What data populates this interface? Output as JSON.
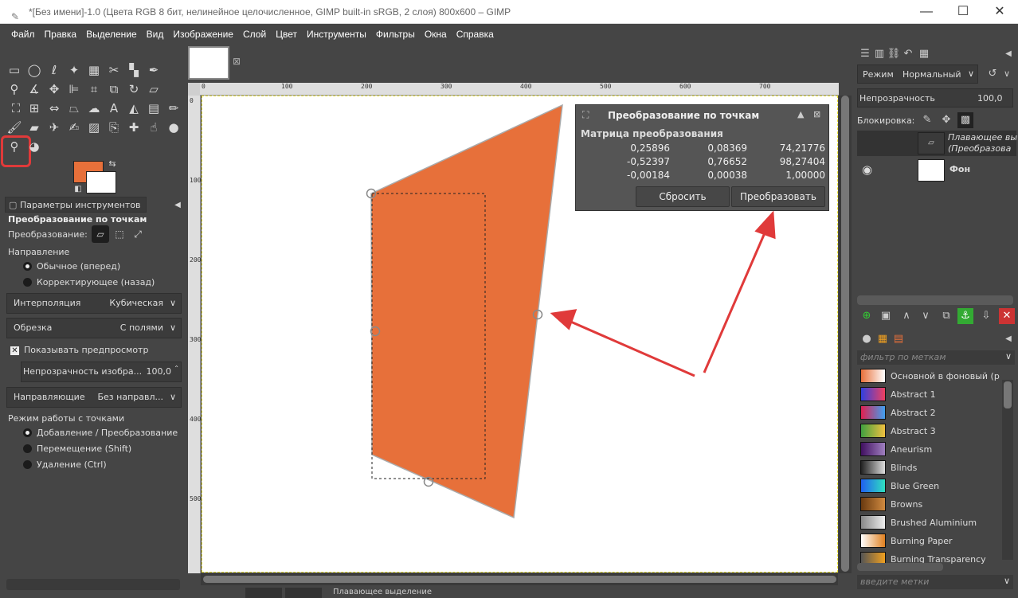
{
  "window": {
    "title": "*[Без имени]-1.0 (Цвета RGB 8 бит, нелинейное целочисленное, GIMP built-in sRGB, 2 слоя) 800x600 – GIMP",
    "minimize": "—",
    "maximize": "☐",
    "close": "✕"
  },
  "menu": [
    "Файл",
    "Правка",
    "Выделение",
    "Вид",
    "Изображение",
    "Слой",
    "Цвет",
    "Инструменты",
    "Фильтры",
    "Окна",
    "Справка"
  ],
  "colors": {
    "foreground": "#e7703a",
    "background": "#ffffff",
    "highlight": "#e03a3a",
    "arrow": "#e03a3a"
  },
  "tool_options": {
    "tab_label": "Параметры инструментов",
    "tool_name": "Преобразование по точкам",
    "transform_label": "Преобразование:",
    "direction_label": "Направление",
    "direction_options": [
      "Обычное (вперед)",
      "Корректирующее (назад)"
    ],
    "interpolation_label": "Интерполяция",
    "interpolation_value": "Кубическая",
    "clipping_label": "Обрезка",
    "clipping_value": "С полями",
    "show_preview_label": "Показывать предпросмотр",
    "preview_opacity_label": "Непрозрачность изобра...",
    "preview_opacity_value": "100,0",
    "guides_label": "Направляющие",
    "guides_value": "Без направл...",
    "point_mode_label": "Режим работы с точками",
    "point_mode_options": [
      "Добавление / Преобразование",
      "Перемещение (Shift)",
      "Удаление (Ctrl)"
    ]
  },
  "ruler": {
    "h_ticks": [
      "0",
      "100",
      "200",
      "300",
      "400",
      "500",
      "600",
      "700"
    ],
    "v_ticks": [
      "0",
      "100",
      "200",
      "300",
      "400",
      "500"
    ]
  },
  "dialog": {
    "title": "Преобразование по точкам",
    "matrix_label": "Матрица преобразования",
    "matrix": [
      [
        "0,25896",
        "0,08369",
        "74,21776"
      ],
      [
        "-0,52397",
        "0,76652",
        "98,27404"
      ],
      [
        "-0,00184",
        "0,00038",
        "1,00000"
      ]
    ],
    "reset_label": "Сбросить",
    "transform_label": "Преобразовать"
  },
  "status": {
    "text": "Плавающее выделение"
  },
  "layers": {
    "mode_label": "Режим",
    "mode_value": "Нормальный",
    "opacity_label": "Непрозрачность",
    "opacity_value": "100,0",
    "lock_label": "Блокировка:",
    "items": [
      {
        "name_line1": "Плавающее вы",
        "name_line2": "(Преобразова"
      },
      {
        "name": "Фон"
      }
    ]
  },
  "gradients": {
    "filter_placeholder": "фильтр по меткам",
    "tags_placeholder": "введите метки",
    "items": [
      {
        "name": "Основной в фоновый (р",
        "c1": "#e7703a",
        "c2": "#ffffff"
      },
      {
        "name": "Abstract 1",
        "c1": "#3040e0",
        "c2": "#f04060"
      },
      {
        "name": "Abstract 2",
        "c1": "#e02050",
        "c2": "#40a0f0"
      },
      {
        "name": "Abstract 3",
        "c1": "#40a040",
        "c2": "#f0c040"
      },
      {
        "name": "Aneurism",
        "c1": "#401060",
        "c2": "#a080c0"
      },
      {
        "name": "Blinds",
        "c1": "#222222",
        "c2": "#dddddd"
      },
      {
        "name": "Blue Green",
        "c1": "#2060f0",
        "c2": "#30e0c0"
      },
      {
        "name": "Browns",
        "c1": "#6a3a10",
        "c2": "#d08a40"
      },
      {
        "name": "Brushed Aluminium",
        "c1": "#888888",
        "c2": "#eeeeee"
      },
      {
        "name": "Burning Paper",
        "c1": "#ffffff",
        "c2": "#e08020"
      },
      {
        "name": "Burning Transparency",
        "c1": "#555555",
        "c2": "#f0a020"
      }
    ]
  }
}
